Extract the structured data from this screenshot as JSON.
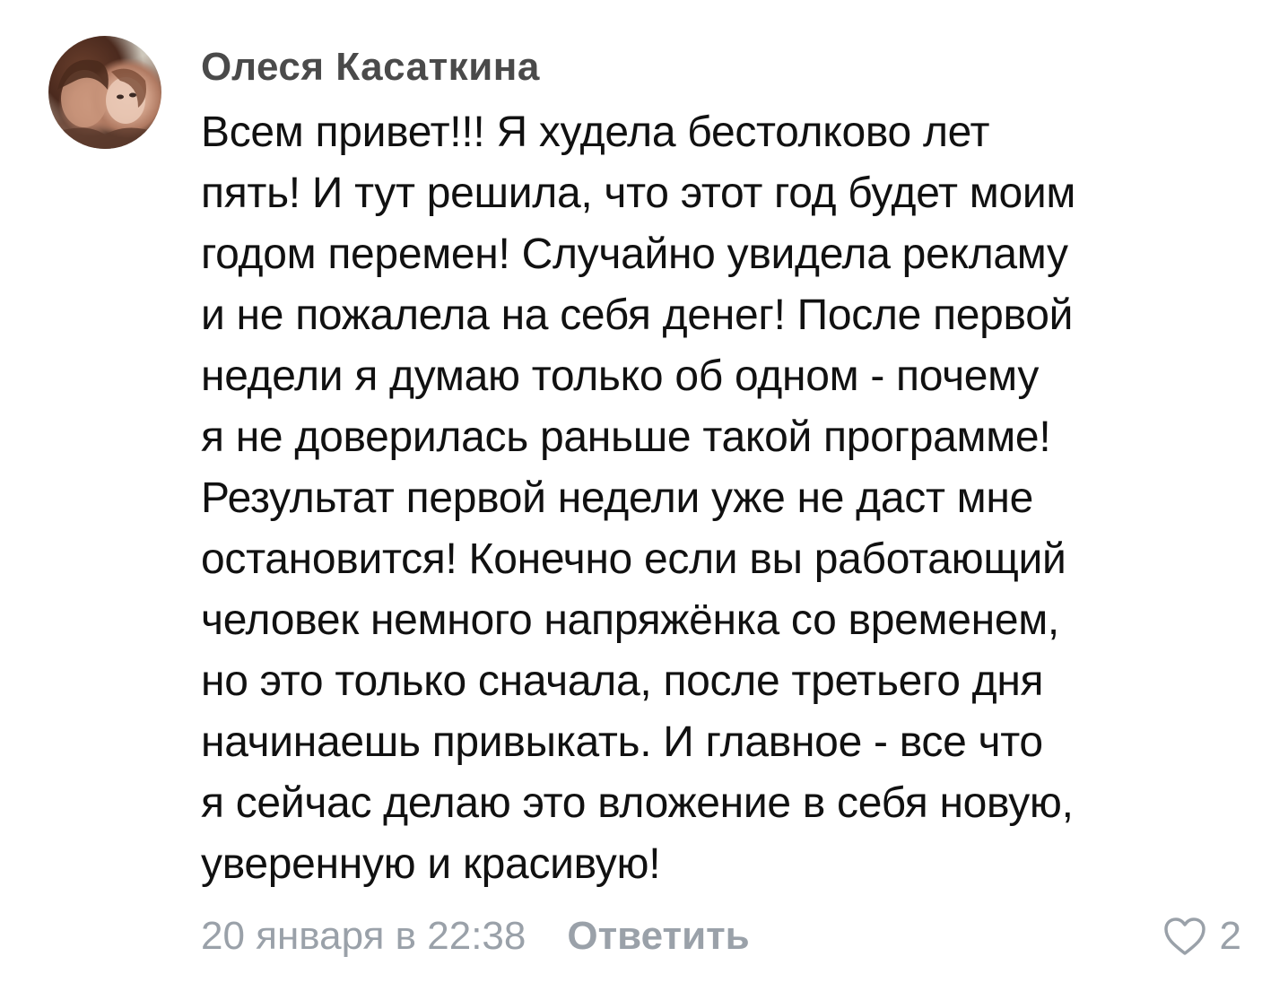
{
  "comment": {
    "author": "Олеся Касаткина",
    "text": "Всем привет!!! Я худела бестолково лет\nпять! И тут решила, что этот год будет моим\nгодом перемен! Случайно увидела рекламу\nи не пожалела на себя денег! После первой\nнедели я думаю только об одном - почему\nя не доверилась раньше такой программе!\nРезультат первой недели уже не даст мне\nостановится! Конечно если вы работающий\nчеловек немного напряжёнка со временем,\nно это только сначала, после третьего дня\nначинаешь привыкать. И главное - все что\nя сейчас делаю это вложение в себя новую,\nуверенную и красивую!",
    "date": "20 января в 22:38",
    "reply_label": "Ответить",
    "like_count": "2",
    "like_icon": "heart-outline-icon",
    "colors": {
      "muted": "#9aa1a9",
      "author": "#4a4a4a",
      "text": "#111111"
    }
  }
}
